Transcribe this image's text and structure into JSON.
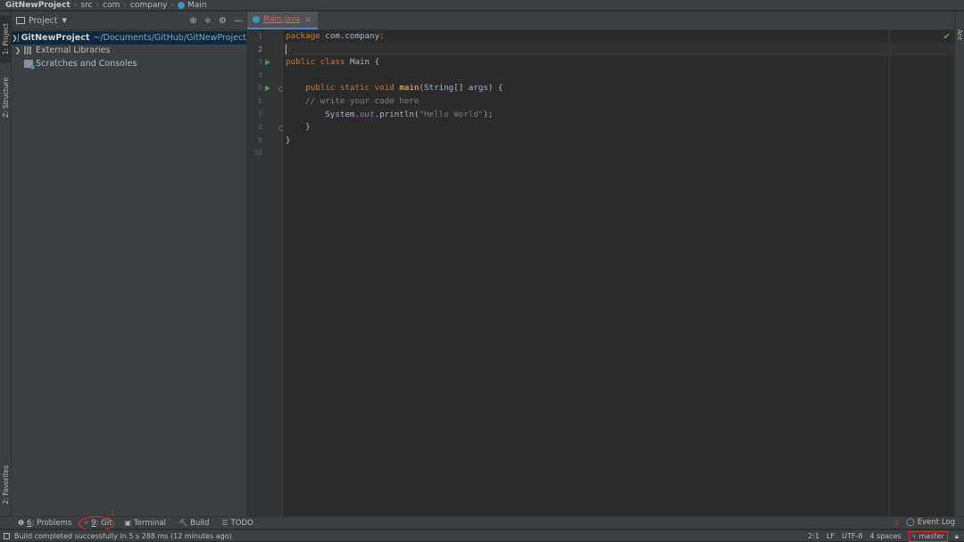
{
  "navbar": {
    "crumbs": [
      "GitNewProject",
      "src",
      "com",
      "company",
      "Main"
    ]
  },
  "left_stripe": {
    "project_tab": "1: Project",
    "structure_tab": "Z: Structure",
    "favorites_tab": "2: Favorites"
  },
  "right_stripe": {
    "ant_tab": "Ant"
  },
  "project_panel": {
    "title": "Project",
    "tree": [
      {
        "label": "GitNewProject",
        "path": "~/Documents/GitHub/GitNewProject"
      },
      {
        "label": "External Libraries"
      },
      {
        "label": "Scratches and Consoles"
      }
    ]
  },
  "editor": {
    "tab": "Main.java",
    "line_numbers": [
      "1",
      "2",
      "3",
      "4",
      "5",
      "6",
      "7",
      "8",
      "9",
      "10"
    ],
    "lines": {
      "l1": {
        "kw": "package",
        "rest": " com.company",
        "semi": ";"
      },
      "l3": {
        "kw1": "public",
        "kw2": "class",
        "rest": " Main {"
      },
      "l5": {
        "indent": "    ",
        "kw1": "public",
        "kw2": "static",
        "kw3": "void",
        "fn": "main",
        "rest": "(String[] args) {"
      },
      "l6": {
        "indent": "    ",
        "comment": "// write your code here"
      },
      "l7": {
        "indent": "        ",
        "pre": "System.",
        "field": "out",
        "mid": ".println(",
        "str": "\"Hello World\"",
        "post": ");"
      },
      "l8": {
        "text": "    }"
      },
      "l9": {
        "text": "}"
      }
    }
  },
  "tool_windows": [
    {
      "icon": "problems-icon",
      "mnemonic": "6",
      "label": ": Problems"
    },
    {
      "icon": "git-icon",
      "mnemonic": "9",
      "label": ": Git"
    },
    {
      "icon": "terminal-icon",
      "label": "Terminal"
    },
    {
      "icon": "build-icon",
      "label": "Build"
    },
    {
      "icon": "todo-icon",
      "label": "TODO"
    }
  ],
  "annotations": {
    "badge1": "1",
    "badge2": "2"
  },
  "event_log": "Event Log",
  "status": {
    "message": "Build completed successfully in 5 s 288 ms (12 minutes ago)",
    "position": "2:1",
    "line_sep": "LF",
    "encoding": "UTF-8",
    "indent": "4 spaces",
    "branch": "master"
  },
  "colors": {
    "accent_blue": "#4a88c7",
    "annotation_red": "#e0302c",
    "keyword": "#cc7832",
    "string": "#6a8759"
  }
}
